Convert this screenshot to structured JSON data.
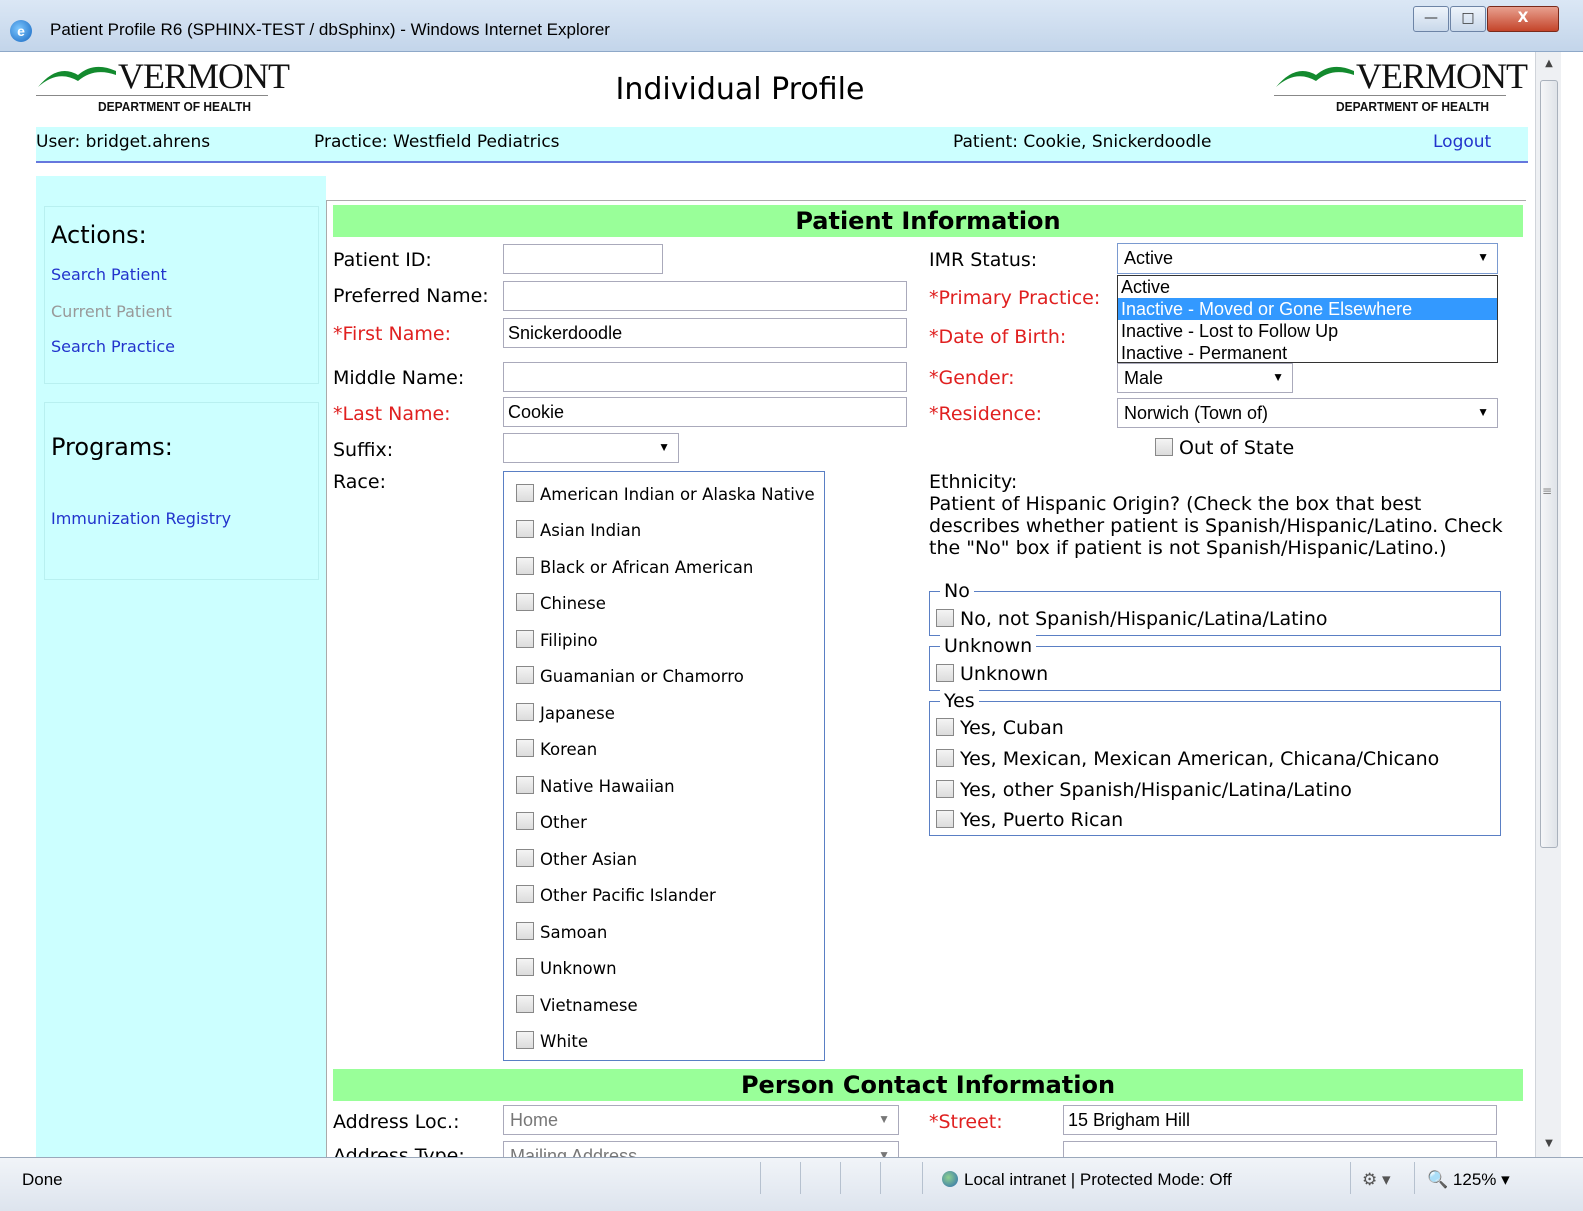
{
  "window": {
    "title": "Patient Profile R6 (SPHINX-TEST / dbSphinx) - Windows Internet Explorer",
    "min_glyph": "—",
    "max_glyph": "□",
    "close_glyph": "X"
  },
  "header": {
    "logo_state": "VERMONT",
    "logo_dept": "DEPARTMENT OF HEALTH",
    "title": "Individual Profile",
    "user": "User: bridget.ahrens",
    "practice": "Practice: Westfield Pediatrics",
    "patient": "Patient: Cookie, Snickerdoodle",
    "logout": "Logout"
  },
  "sidebar": {
    "actions_heading": "Actions:",
    "actions": [
      "Search Patient",
      "Current Patient",
      "Search Practice"
    ],
    "programs_heading": "Programs:",
    "programs": [
      "Immunization Registry"
    ]
  },
  "patient_info": {
    "section_title": "Patient Information",
    "labels": {
      "patient_id": "Patient ID:",
      "preferred_name": "Preferred Name:",
      "first_name": "*First Name:",
      "middle_name": "Middle Name:",
      "last_name": "*Last Name:",
      "suffix": "Suffix:",
      "race": "Race:",
      "imr_status": "IMR Status:",
      "primary_practice": "*Primary Practice:",
      "dob": "*Date of Birth:",
      "gender": "*Gender:",
      "residence": "*Residence:",
      "out_of_state": "Out of State"
    },
    "values": {
      "patient_id": "",
      "preferred_name": "",
      "first_name": "Snickerdoodle",
      "middle_name": "",
      "last_name": "Cookie",
      "suffix": "",
      "imr_status": "Active",
      "gender": "Male",
      "residence": "Norwich (Town of)"
    },
    "imr_options": [
      "Active",
      "Inactive - Moved or Gone Elsewhere",
      "Inactive - Lost to Follow Up",
      "Inactive - Permanent"
    ],
    "imr_highlighted": "Inactive - Moved or Gone Elsewhere",
    "race_options": [
      "American Indian or Alaska Native",
      "Asian Indian",
      "Black or African American",
      "Chinese",
      "Filipino",
      "Guamanian or Chamorro",
      "Japanese",
      "Korean",
      "Native Hawaiian",
      "Other",
      "Other Asian",
      "Other Pacific Islander",
      "Samoan",
      "Unknown",
      "Vietnamese",
      "White"
    ],
    "ethnicity": {
      "intro": "Ethnicity:",
      "question": "Patient of Hispanic Origin? (Check the box that best describes whether patient is Spanish/Hispanic/Latino. Check the \"No\" box if patient is not Spanish/Hispanic/Latino.)",
      "groups": [
        {
          "legend": "No",
          "options": [
            "No, not Spanish/Hispanic/Latina/Latino"
          ]
        },
        {
          "legend": "Unknown",
          "options": [
            "Unknown"
          ]
        },
        {
          "legend": "Yes",
          "options": [
            "Yes, Cuban",
            "Yes, Mexican, Mexican American, Chicana/Chicano",
            "Yes, other Spanish/Hispanic/Latina/Latino",
            "Yes, Puerto Rican"
          ]
        }
      ]
    }
  },
  "contact_info": {
    "section_title": "Person Contact Information",
    "address_loc_label": "Address Loc.:",
    "address_loc_value": "Home",
    "address_type_label": "Address Type:",
    "address_type_value": "Mailing Address",
    "street_label": "*Street:",
    "street_value": "15 Brigham Hill"
  },
  "statusbar": {
    "status": "Done",
    "zone": "Local intranet | Protected Mode: Off",
    "zoom": "125%"
  }
}
